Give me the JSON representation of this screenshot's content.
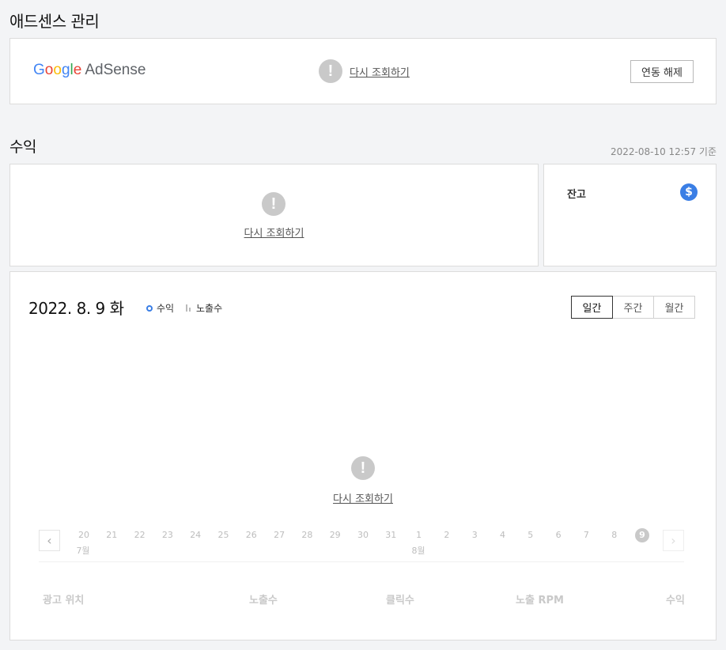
{
  "page_title": "애드센스 관리",
  "adsense": {
    "logo_google": "Google",
    "logo_adsense": "AdSense",
    "retry_label": "다시 조회하기",
    "disconnect_label": "연동 해제"
  },
  "revenue": {
    "title": "수익",
    "timestamp": "2022-08-10 12:57 기준",
    "retry_label": "다시 조회하기",
    "balance_label": "잔고",
    "balance_icon": "$"
  },
  "chart": {
    "date": "2022. 8. 9 화",
    "legend": [
      "수익",
      "노출수"
    ],
    "tabs": [
      "일간",
      "주간",
      "월간"
    ],
    "retry_label": "다시 조회하기",
    "days": [
      "20",
      "21",
      "22",
      "23",
      "24",
      "25",
      "26",
      "27",
      "28",
      "29",
      "30",
      "31",
      "1",
      "2",
      "3",
      "4",
      "5",
      "6",
      "7",
      "8",
      "9"
    ],
    "month_labels": {
      "first": "7월",
      "second": "8월"
    },
    "selected_day": "9",
    "prev_icon": "‹",
    "next_icon": "›",
    "table_headers": [
      "광고 위치",
      "노출수",
      "클릭수",
      "노출 RPM",
      "수익"
    ],
    "accent": "#3a7ee5",
    "balance_icon_color": "#3a7ee5"
  }
}
